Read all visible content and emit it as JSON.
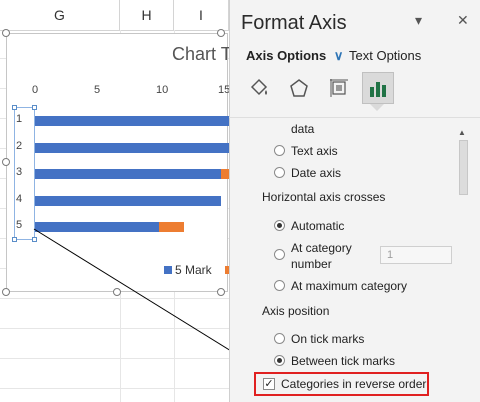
{
  "spreadsheet": {
    "columns": [
      "G",
      "H",
      "I"
    ]
  },
  "chart": {
    "title": "Chart T",
    "legend": [
      {
        "label": "5 Mark",
        "color": "#4472c4"
      },
      {
        "label": "",
        "color": "#ed7d31"
      }
    ]
  },
  "chart_data": {
    "type": "bar",
    "orientation": "horizontal",
    "categories": [
      "1",
      "2",
      "3",
      "4",
      "5"
    ],
    "x_ticks": [
      "0",
      "5",
      "10",
      "15"
    ],
    "series": [
      {
        "name": "5 Mark",
        "color": "#4472c4",
        "values": [
          16,
          16,
          15,
          15,
          10
        ]
      },
      {
        "name": "",
        "color": "#ed7d31",
        "values": [
          0,
          0,
          1,
          0,
          2
        ]
      }
    ],
    "title": "Chart T",
    "xlim": [
      0,
      15
    ],
    "categories_reversed": true,
    "legend_position": "bottom"
  },
  "pane": {
    "title": "Format Axis",
    "dropdown_glyph": "▾",
    "close_glyph": "✕",
    "tabs": [
      {
        "label": "Axis Options",
        "chevron": "∨",
        "active": true
      },
      {
        "label": "Text Options",
        "active": false
      }
    ],
    "icons": [
      {
        "name": "fill-line-icon"
      },
      {
        "name": "effects-icon"
      },
      {
        "name": "size-properties-icon"
      },
      {
        "name": "axis-options-icon"
      }
    ],
    "options": {
      "date_type_partial": "data",
      "text_axis": "Text axis",
      "date_axis": "Date axis",
      "horizontal_crosses_label": "Horizontal axis crosses",
      "automatic": "Automatic",
      "at_category_line1": "At category",
      "at_category_line2": "number",
      "at_category_value": "1",
      "at_maximum": "At maximum category",
      "axis_position_label": "Axis position",
      "on_tick_marks": "On tick marks",
      "between_tick_marks": "Between tick marks",
      "reverse_order": "Categories in reverse order",
      "reverse_checked_glyph": "✓"
    },
    "scroll_up_glyph": "▲"
  }
}
